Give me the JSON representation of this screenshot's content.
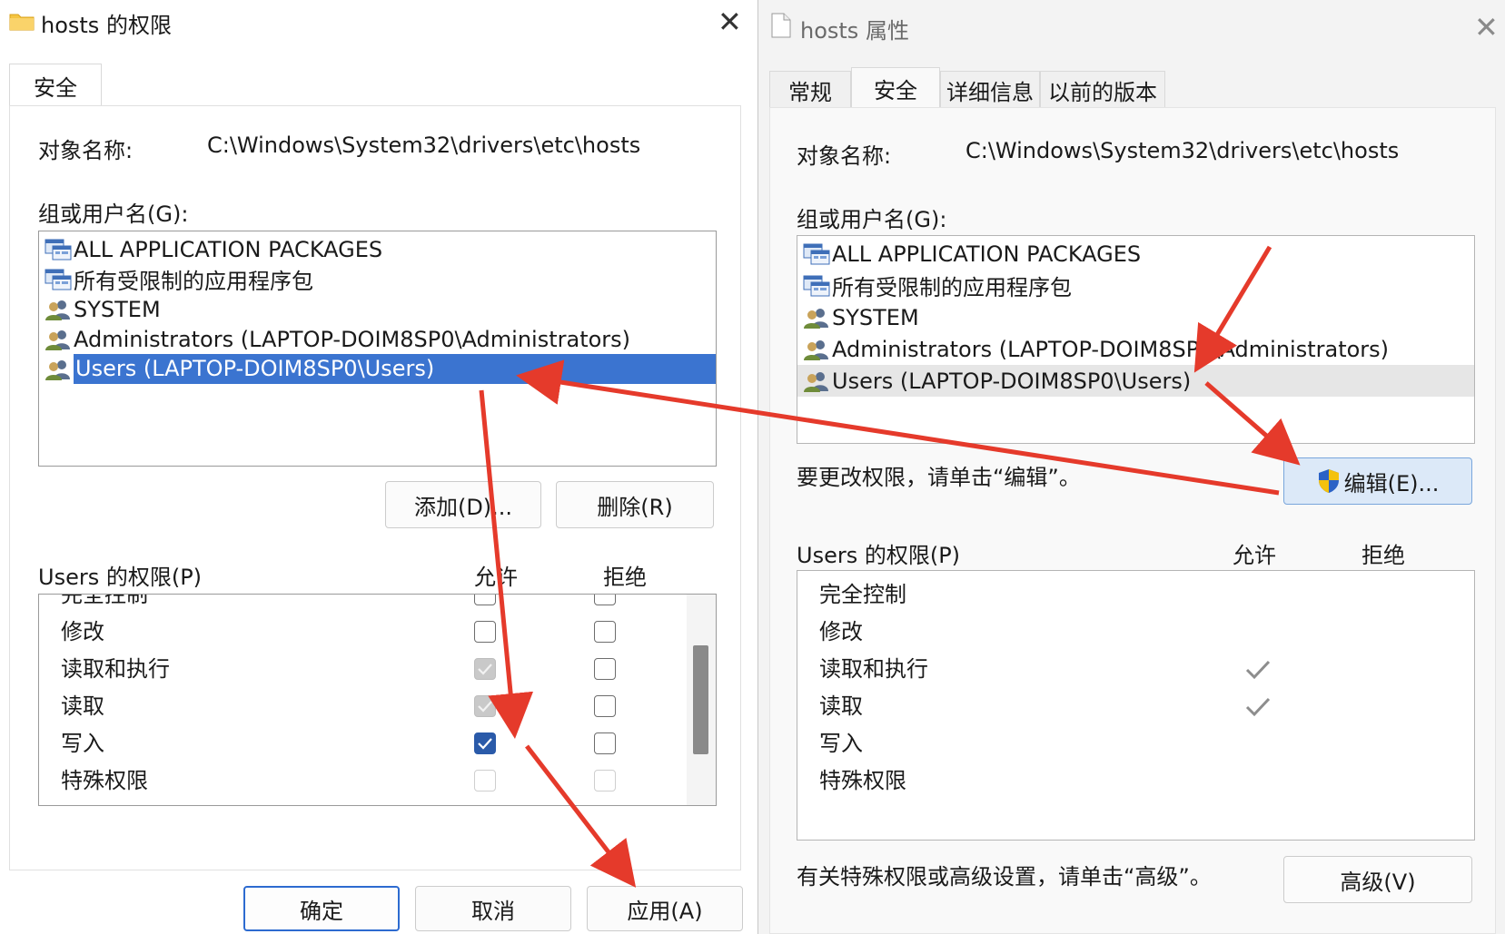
{
  "left_dialog": {
    "title": "hosts 的权限",
    "tab": "安全",
    "object_label": "对象名称:",
    "object_path": "C:\\Windows\\System32\\drivers\\etc\\hosts",
    "group_label": "组或用户名(G):",
    "groups": [
      {
        "name": "ALL APPLICATION PACKAGES",
        "icon": "app-packages-icon",
        "selected": false
      },
      {
        "name": "所有受限制的应用程序包",
        "icon": "app-packages-icon",
        "selected": false
      },
      {
        "name": "SYSTEM",
        "icon": "users-group-icon",
        "selected": false
      },
      {
        "name": "Administrators (LAPTOP-DOIM8SP0\\Administrators)",
        "icon": "users-group-icon",
        "selected": false
      },
      {
        "name": "Users (LAPTOP-DOIM8SP0\\Users)",
        "icon": "users-group-icon",
        "selected": true
      }
    ],
    "add_button": "添加(D)...",
    "remove_button": "删除(R)",
    "perm_label": "Users 的权限(P)",
    "allow_header": "允许",
    "deny_header": "拒绝",
    "permissions": [
      {
        "name": "完全控制",
        "allow": "unchecked",
        "deny": "unchecked"
      },
      {
        "name": "修改",
        "allow": "unchecked",
        "deny": "unchecked"
      },
      {
        "name": "读取和执行",
        "allow": "grayed",
        "deny": "unchecked"
      },
      {
        "name": "读取",
        "allow": "grayed",
        "deny": "unchecked"
      },
      {
        "name": "写入",
        "allow": "checked",
        "deny": "unchecked"
      },
      {
        "name": "特殊权限",
        "allow": "disabled",
        "deny": "disabled"
      }
    ],
    "ok_button": "确定",
    "cancel_button": "取消",
    "apply_button": "应用(A)"
  },
  "right_dialog": {
    "title": "hosts 属性",
    "tabs": [
      {
        "label": "常规",
        "active": false
      },
      {
        "label": "安全",
        "active": true
      },
      {
        "label": "详细信息",
        "active": false
      },
      {
        "label": "以前的版本",
        "active": false
      }
    ],
    "object_label": "对象名称:",
    "object_path": "C:\\Windows\\System32\\drivers\\etc\\hosts",
    "group_label": "组或用户名(G):",
    "groups": [
      {
        "name": "ALL APPLICATION PACKAGES",
        "icon": "app-packages-icon",
        "hover": false
      },
      {
        "name": "所有受限制的应用程序包",
        "icon": "app-packages-icon",
        "hover": false
      },
      {
        "name": "SYSTEM",
        "icon": "users-group-icon",
        "hover": false
      },
      {
        "name": "Administrators (LAPTOP-DOIM8SP0\\Administrators)",
        "icon": "users-group-icon",
        "hover": false
      },
      {
        "name": "Users (LAPTOP-DOIM8SP0\\Users)",
        "icon": "users-group-icon",
        "hover": true
      }
    ],
    "edit_hint": "要更改权限，请单击“编辑”。",
    "edit_button": "编辑(E)...",
    "perm_label": "Users 的权限(P)",
    "allow_header": "允许",
    "deny_header": "拒绝",
    "permissions": [
      {
        "name": "完全控制",
        "allow": false,
        "deny": false
      },
      {
        "name": "修改",
        "allow": false,
        "deny": false
      },
      {
        "name": "读取和执行",
        "allow": true,
        "deny": false
      },
      {
        "name": "读取",
        "allow": true,
        "deny": false
      },
      {
        "name": "写入",
        "allow": false,
        "deny": false
      },
      {
        "name": "特殊权限",
        "allow": false,
        "deny": false
      }
    ],
    "advanced_hint": "有关特殊权限或高级设置，请单击“高级”。",
    "advanced_button": "高级(V)"
  },
  "colors": {
    "selection": "#3b74d0",
    "checkbox_checked": "#2a5aa9",
    "annotation_arrow": "#e53a2b",
    "edit_button_bg": "#dce9f8"
  }
}
